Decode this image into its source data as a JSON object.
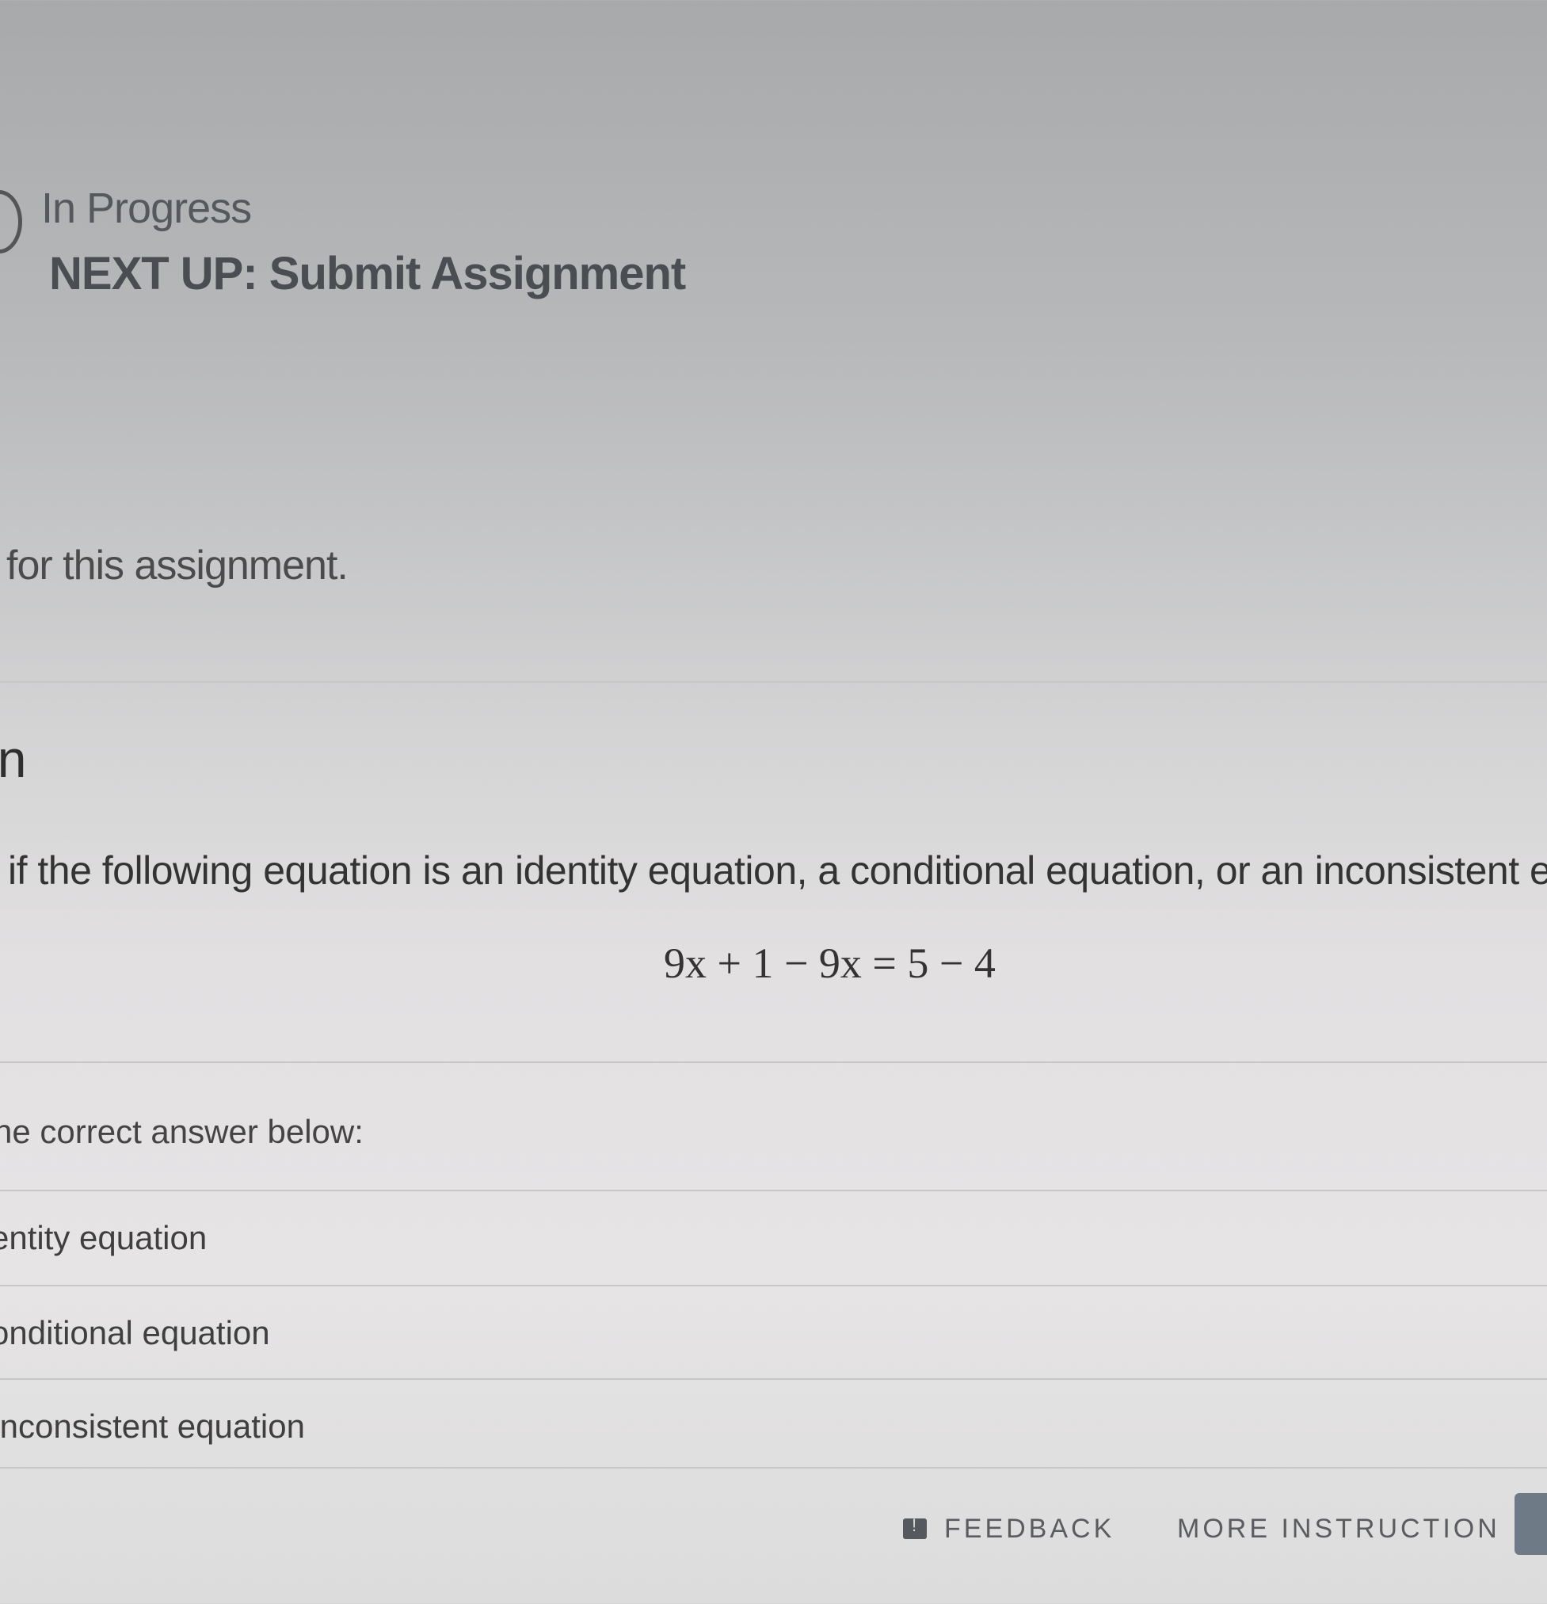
{
  "progress": {
    "status": "In Progress",
    "next_up": "NEXT UP: Submit Assignment"
  },
  "assignment_note": "for this assignment.",
  "question": {
    "section_title": "on",
    "prompt": "if the following equation is an identity equation, a conditional equation, or an inconsistent equa",
    "equation": "9x + 1 − 9x = 5 − 4",
    "instruction": "he correct answer below:",
    "options": [
      "entity equation",
      "onditional equation",
      "Inconsistent equation"
    ]
  },
  "footer": {
    "feedback_label": "FEEDBACK",
    "more_instruction_label": "MORE INSTRUCTION"
  }
}
